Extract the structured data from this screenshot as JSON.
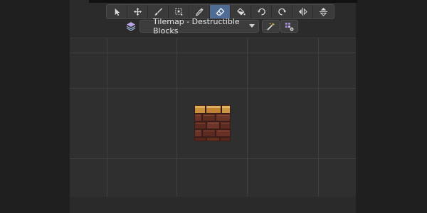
{
  "toolbar": {
    "tools": [
      {
        "name": "select-tool",
        "icon": "arrow-cursor-icon",
        "active": false
      },
      {
        "name": "move-tool",
        "icon": "move-arrows-icon",
        "active": false
      },
      {
        "name": "paint-tool",
        "icon": "brush-icon",
        "active": false
      },
      {
        "name": "rect-select-tool",
        "icon": "rect-select-icon",
        "active": false
      },
      {
        "name": "picker-tool",
        "icon": "eyedropper-icon",
        "active": false
      },
      {
        "name": "eraser-tool",
        "icon": "eraser-icon",
        "active": true
      },
      {
        "name": "fill-tool",
        "icon": "bucket-icon",
        "active": false
      },
      {
        "name": "rotate-left-tool",
        "icon": "rotate-left-icon",
        "active": false
      },
      {
        "name": "rotate-right-tool",
        "icon": "rotate-right-icon",
        "active": false
      },
      {
        "name": "flip-h-tool",
        "icon": "flip-horizontal-icon",
        "active": false
      },
      {
        "name": "flip-v-tool",
        "icon": "flip-vertical-icon",
        "active": false
      }
    ]
  },
  "tilemap": {
    "selected_layer": "Tilemap - Destructible Blocks"
  },
  "colors": {
    "accent": "#4f6c94",
    "brick_top": "#c98f3a",
    "brick_body": "#5a2e22"
  }
}
